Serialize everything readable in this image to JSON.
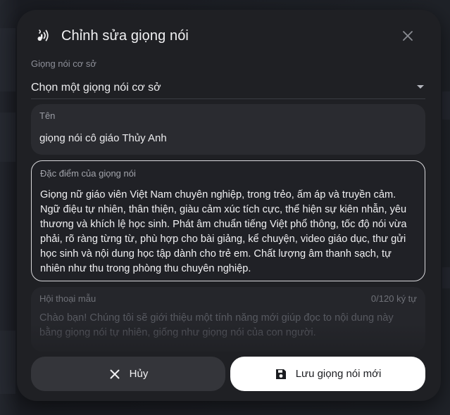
{
  "dialog": {
    "title": "Chỉnh sửa giọng nói",
    "title_icon": "voice-wave-icon",
    "close_icon": "close-icon"
  },
  "base_voice": {
    "label": "Giọng nói cơ sở",
    "value": "Chọn một giọng nói cơ sở"
  },
  "name_field": {
    "label": "Tên",
    "value": "giọng nói cô giáo Thủy Anh"
  },
  "description_field": {
    "label": "Đặc điểm của giọng nói",
    "value": "Giọng nữ giáo viên Việt Nam chuyên nghiệp, trong trẻo, ấm áp và truyền cảm. Ngữ điệu tự nhiên, thân thiện, giàu cảm xúc tích cực, thể hiện sự kiên nhẫn, yêu thương và khích lệ học sinh. Phát âm chuẩn tiếng Việt phổ thông, tốc độ nói vừa phải, rõ ràng từng từ, phù hợp cho bài giảng, kể chuyện, video giáo dục, thư gửi học sinh và nội dung học tập dành cho trẻ em. Chất lượng âm thanh sạch, tự nhiên như thu trong phòng thu chuyên nghiệp."
  },
  "sample_dialog": {
    "label": "Hội thoại mẫu",
    "counter": "0/120 ký tự",
    "placeholder": "Chào bạn! Chúng tôi sẽ giới thiệu một tính năng mới giúp đọc to nội dung này bằng giọng nói tự nhiên, giống như giọng nói của con người."
  },
  "buttons": {
    "cancel_label": "Hủy",
    "save_label": "Lưu giọng nói mới"
  },
  "colors": {
    "modal_bg": "#1f2024",
    "field_bg": "#2a2b30",
    "save_bg": "#ffffff",
    "cancel_bg": "#34353a"
  }
}
